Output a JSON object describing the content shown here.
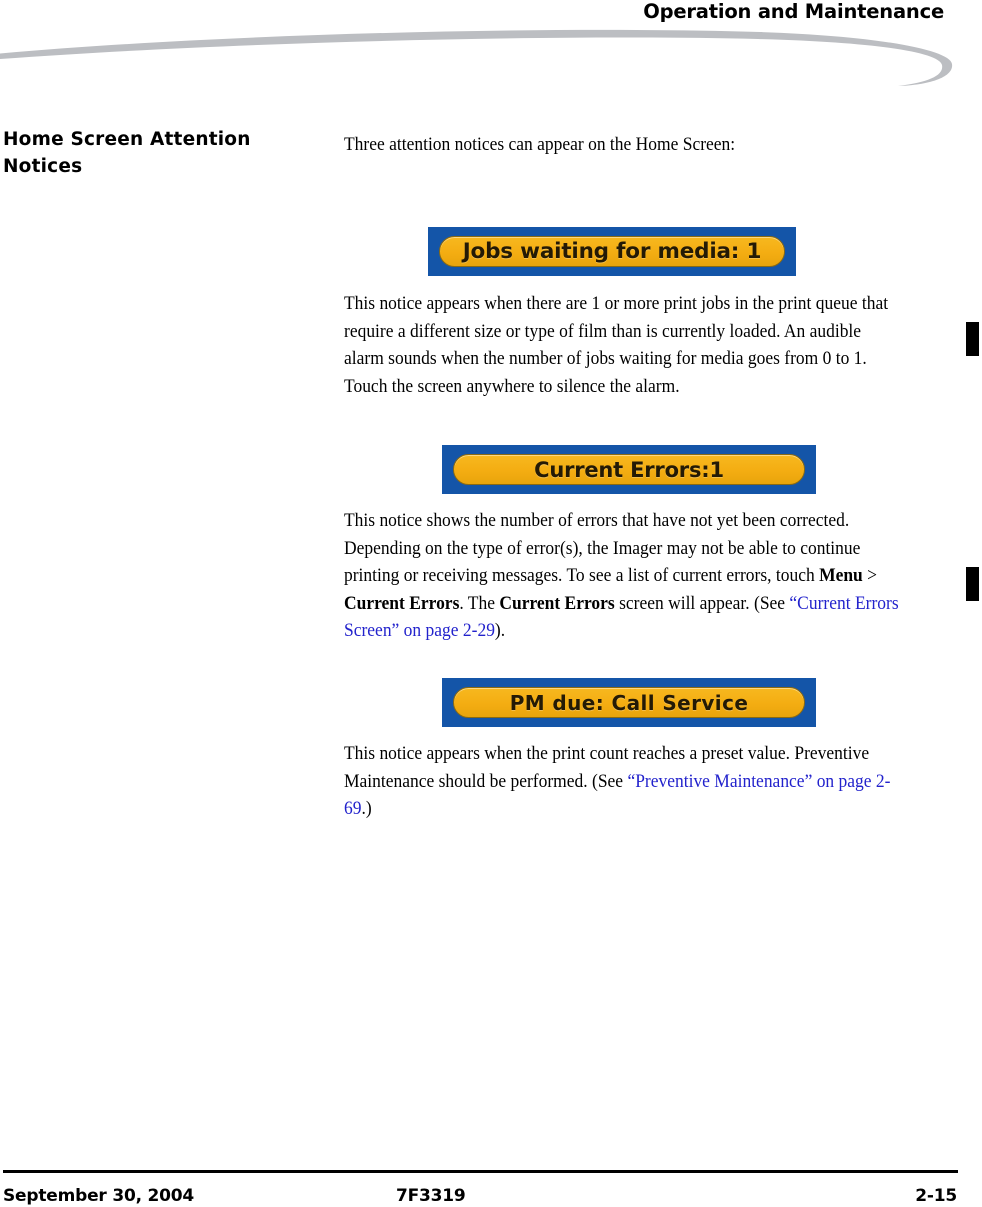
{
  "header": {
    "title": "Operation and Maintenance",
    "swoosh_color": "#bcbec2"
  },
  "section": {
    "heading": "Home Screen Attention Notices"
  },
  "body": {
    "intro": "Three attention notices can appear on the Home Screen:",
    "paragraph_jobs": {
      "line": "This notice appears when there are 1 or more print jobs in the print queue that require a different size or type of film than is currently loaded. An audible alarm sounds when the number of jobs waiting for media goes from 0 to 1. Touch the screen anywhere to silence the alarm."
    },
    "paragraph_errors": {
      "part1": "This notice shows the number of errors that have not yet been corrected. Depending on the type of error(s), the Imager may not be able to continue printing or receiving messages. To see a list of current errors, touch ",
      "bold1": "Menu",
      "part2": " > ",
      "bold2": "Current Errors",
      "part3": ". The ",
      "bold3": "Current Errors",
      "part4": " screen will appear. (See ",
      "link": "“Current Errors Screen” on page 2-29",
      "part5": ")."
    },
    "paragraph_pm": {
      "part1": "This notice appears when the print count reaches a preset value. Preventive Maintenance should be performed. (See ",
      "link": "“Preventive Maintenance” on page 2-69",
      "part2": ".)"
    }
  },
  "notices": [
    {
      "name": "jobs-waiting-for-media",
      "label": "Jobs waiting for media: 1",
      "frame_color": "#1455a8",
      "pill_color": "#f4ad12"
    },
    {
      "name": "current-errors",
      "label": "Current Errors:1",
      "frame_color": "#1455a8",
      "pill_color": "#f4ad12"
    },
    {
      "name": "pm-due-call-service",
      "label": "PM due: Call Service",
      "frame_color": "#1455a8",
      "pill_color": "#f4ad12"
    }
  ],
  "footer": {
    "date": "September 30, 2004",
    "document_number": "7F3319",
    "page_number": "2-15"
  }
}
